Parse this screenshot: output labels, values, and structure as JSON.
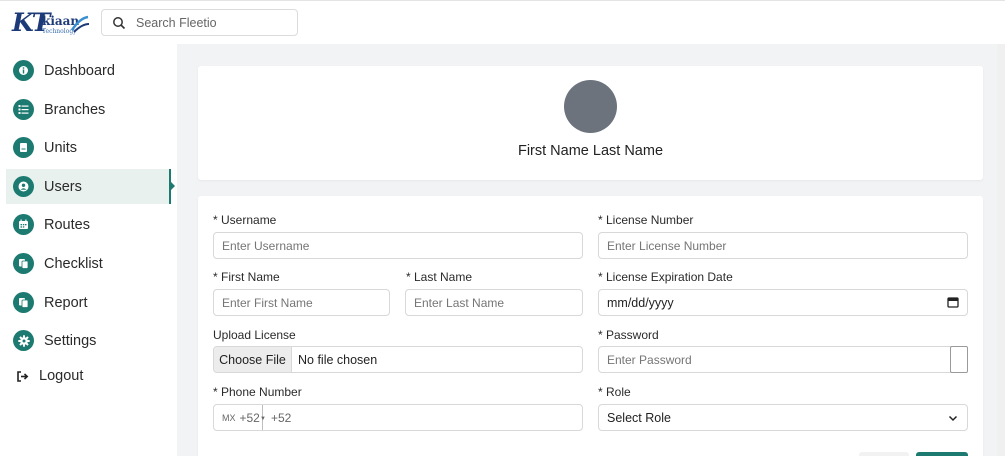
{
  "brand": {
    "logo_mark": "KT",
    "logo_word": "kiaan",
    "logo_sub": "Technology"
  },
  "search": {
    "placeholder": "Search Fleetio"
  },
  "colors": {
    "accent": "#1c7a70",
    "avatar": "#6c737c",
    "brand": "#1d3a78"
  },
  "sidebar": {
    "items": [
      {
        "label": "Dashboard",
        "icon": "info-icon",
        "active": false
      },
      {
        "label": "Branches",
        "icon": "list-icon",
        "active": false
      },
      {
        "label": "Units",
        "icon": "document-icon",
        "active": false
      },
      {
        "label": "Users",
        "icon": "user-circle-icon",
        "active": true
      },
      {
        "label": "Routes",
        "icon": "calendar-icon",
        "active": false
      },
      {
        "label": "Checklist",
        "icon": "copy-icon",
        "active": false
      },
      {
        "label": "Report",
        "icon": "copy-icon",
        "active": false
      },
      {
        "label": "Settings",
        "icon": "gear-icon",
        "active": false
      }
    ],
    "logout": {
      "label": "Logout",
      "icon": "logout-icon"
    }
  },
  "profile": {
    "full_name": "First Name Last Name"
  },
  "form": {
    "username": {
      "label": "* Username",
      "placeholder": "Enter Username"
    },
    "first_name": {
      "label": "* First Name",
      "placeholder": "Enter First Name"
    },
    "last_name": {
      "label": "* Last Name",
      "placeholder": "Enter Last Name"
    },
    "upload_license": {
      "label": "Upload License",
      "button": "Choose File",
      "status": "No file chosen"
    },
    "phone": {
      "label": "* Phone Number",
      "country_code": "MX",
      "country_prefix": "+52",
      "value": "+52"
    },
    "license_number": {
      "label": "* License Number",
      "placeholder": "Enter License Number"
    },
    "license_expiration": {
      "label": "* License Expiration Date",
      "value": "mm/dd/yyyy"
    },
    "password": {
      "label": "* Password",
      "placeholder": "Enter Password"
    },
    "role": {
      "label": "* Role",
      "value": "Select Role"
    }
  }
}
